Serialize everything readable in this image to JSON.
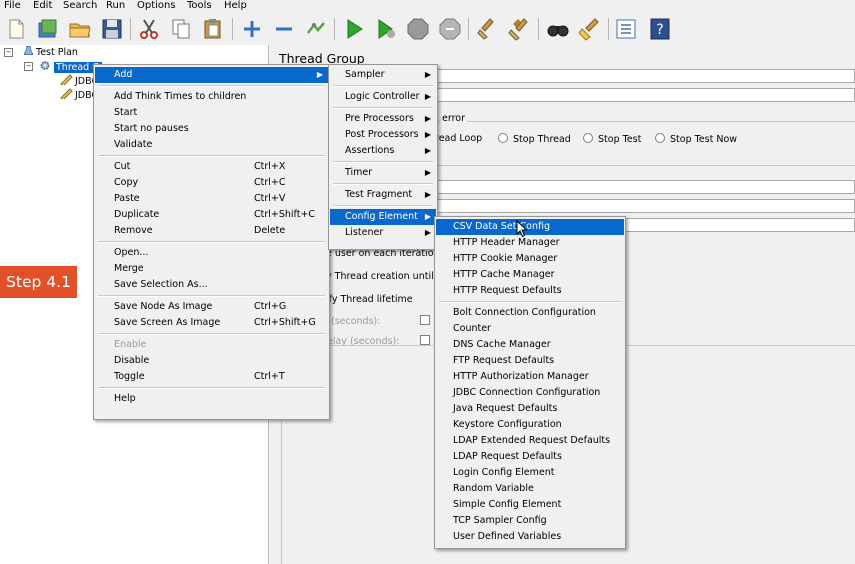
{
  "menubar": [
    "File",
    "Edit",
    "Search",
    "Run",
    "Options",
    "Tools",
    "Help"
  ],
  "toolbar_icons": [
    "new-icon",
    "templates-icon",
    "open-icon",
    "save-icon",
    "cut-icon",
    "copy-icon",
    "paste-icon",
    "expand-icon",
    "collapse-icon",
    "toggle-icon",
    "start-icon",
    "start-no-pauses-icon",
    "stop-icon",
    "shutdown-icon",
    "clear-icon",
    "clear-all-icon",
    "search-icon",
    "reset-search-icon",
    "function-helper-icon",
    "help-icon"
  ],
  "tree": {
    "root": "Test Plan",
    "thread_group": "Thread G",
    "children": [
      "JDBC",
      "JDBC"
    ]
  },
  "panel": {
    "title": "Thread Group",
    "error_label": "error",
    "radios": [
      "read Loop",
      "Stop Thread",
      "Stop Test",
      "Stop Test Now"
    ],
    "fragments": [
      "e user on each iteration",
      "y Thread creation until n",
      "ify Thread lifetime",
      "(seconds):",
      "elay (seconds):"
    ]
  },
  "context_menu": [
    {
      "label": "Add",
      "submenu": true,
      "highlight": true
    },
    {
      "sep": true
    },
    {
      "label": "Add Think Times to children"
    },
    {
      "label": "Start"
    },
    {
      "label": "Start no pauses"
    },
    {
      "label": "Validate"
    },
    {
      "sep": true
    },
    {
      "label": "Cut",
      "shortcut": "Ctrl+X"
    },
    {
      "label": "Copy",
      "shortcut": "Ctrl+C"
    },
    {
      "label": "Paste",
      "shortcut": "Ctrl+V"
    },
    {
      "label": "Duplicate",
      "shortcut": "Ctrl+Shift+C"
    },
    {
      "label": "Remove",
      "shortcut": "Delete"
    },
    {
      "sep": true
    },
    {
      "label": "Open..."
    },
    {
      "label": "Merge"
    },
    {
      "label": "Save Selection As..."
    },
    {
      "sep": true
    },
    {
      "label": "Save Node As Image",
      "shortcut": "Ctrl+G"
    },
    {
      "label": "Save Screen As Image",
      "shortcut": "Ctrl+Shift+G"
    },
    {
      "sep": true
    },
    {
      "label": "Enable",
      "disabled": true
    },
    {
      "label": "Disable"
    },
    {
      "label": "Toggle",
      "shortcut": "Ctrl+T"
    },
    {
      "sep": true
    },
    {
      "label": "Help"
    }
  ],
  "add_submenu": [
    {
      "label": "Sampler",
      "submenu": true
    },
    {
      "sep": true
    },
    {
      "label": "Logic Controller",
      "submenu": true
    },
    {
      "sep": true
    },
    {
      "label": "Pre Processors",
      "submenu": true
    },
    {
      "label": "Post Processors",
      "submenu": true
    },
    {
      "label": "Assertions",
      "submenu": true
    },
    {
      "sep": true
    },
    {
      "label": "Timer",
      "submenu": true
    },
    {
      "sep": true
    },
    {
      "label": "Test Fragment",
      "submenu": true
    },
    {
      "sep": true
    },
    {
      "label": "Config Element",
      "submenu": true,
      "highlight": true
    },
    {
      "label": "Listener",
      "submenu": true
    }
  ],
  "config_submenu": [
    {
      "label": "CSV Data Set Config",
      "highlight": true
    },
    {
      "label": "HTTP Header Manager"
    },
    {
      "label": "HTTP Cookie Manager"
    },
    {
      "label": "HTTP Cache Manager"
    },
    {
      "label": "HTTP Request Defaults"
    },
    {
      "sep": true
    },
    {
      "label": "Bolt Connection Configuration"
    },
    {
      "label": "Counter"
    },
    {
      "label": "DNS Cache Manager"
    },
    {
      "label": "FTP Request Defaults"
    },
    {
      "label": "HTTP Authorization Manager"
    },
    {
      "label": "JDBC Connection Configuration"
    },
    {
      "label": "Java Request Defaults"
    },
    {
      "label": "Keystore Configuration"
    },
    {
      "label": "LDAP Extended Request Defaults"
    },
    {
      "label": "LDAP Request Defaults"
    },
    {
      "label": "Login Config Element"
    },
    {
      "label": "Random Variable"
    },
    {
      "label": "Simple Config Element"
    },
    {
      "label": "TCP Sampler Config"
    },
    {
      "label": "User Defined Variables"
    }
  ],
  "step_label": "Step 4.1",
  "colors": {
    "highlight": "#0a68cc",
    "badge": "#e2502a"
  }
}
